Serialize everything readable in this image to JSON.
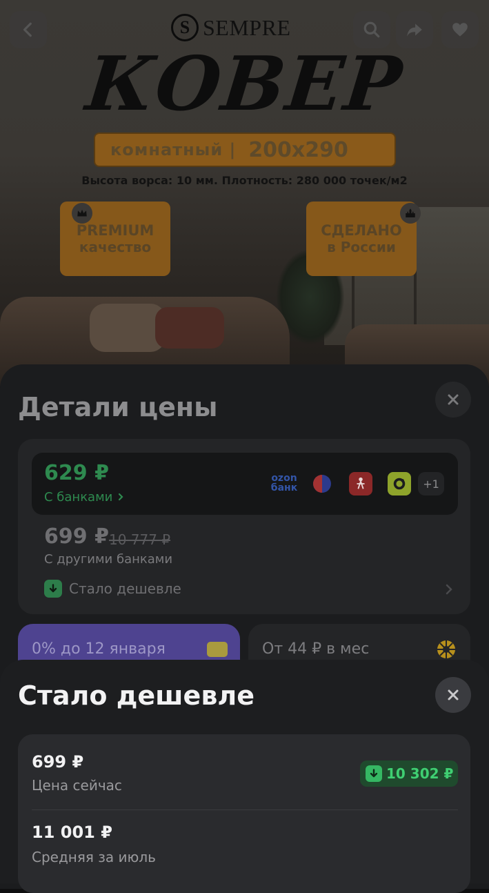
{
  "product_banner": {
    "brand": "SEMPRE",
    "brand_logo_letter": "S",
    "title": "КОВЕР",
    "room_label": "комнатный |",
    "size_label": "200x290",
    "spec": "Высота ворса: 10 мм. Плотность: 280 000 точек/м2",
    "badge_left": {
      "line1": "PREMIUM",
      "line2": "качество"
    },
    "badge_right": {
      "line1": "СДЕЛАНО",
      "line2": "в России"
    }
  },
  "top_bar": {
    "icons": [
      "back-arrow-icon",
      "search-icon",
      "share-icon",
      "heart-icon"
    ]
  },
  "price_details": {
    "title": "Детали цены",
    "bank_price": "629 ₽",
    "bank_link": "С банками",
    "bank_logo_ozon": "ozon\nбанк",
    "banks_more": "+1",
    "other_price": "699 ₽",
    "old_price": "10 777 ₽",
    "other_label": "С другими банками",
    "cheaper_label": "Стало дешевле",
    "promo_installment": "0% до 12 января",
    "promo_monthly": "От 44 ₽ в мес"
  },
  "cheaper_sheet": {
    "title": "Стало дешевле",
    "current_price": "699 ₽",
    "current_label": "Цена сейчас",
    "drop_amount": "10 302 ₽",
    "avg_price": "11 001 ₽",
    "avg_label": "Средняя за июль"
  },
  "colors": {
    "green": "#2e8a4f",
    "accent_green": "#3fcf72",
    "promo_purple": "#4e4390",
    "badge_orange": "#86581a"
  }
}
